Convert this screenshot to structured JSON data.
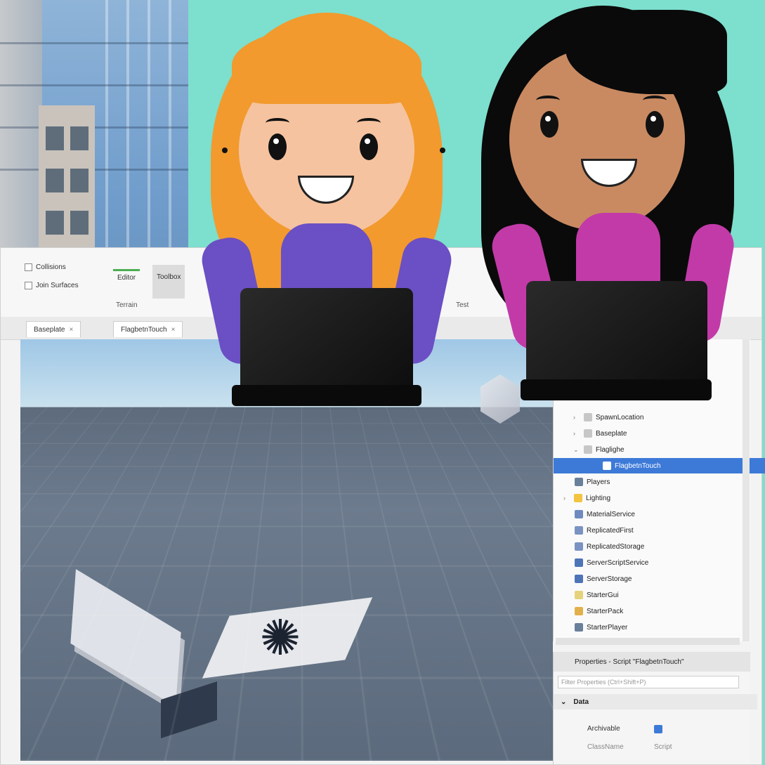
{
  "ribbon": {
    "checkbox_1": "Collisions",
    "checkbox_2": "Join Surfaces",
    "btn_1": "Editor",
    "btn_2": "Toolbox",
    "group_1": "Terrain",
    "group_2": "Test"
  },
  "tabs": [
    {
      "label": "Baseplate"
    },
    {
      "label": "FlagbetnTouch"
    }
  ],
  "explorer": {
    "items": [
      {
        "label": "SpawnLocation"
      },
      {
        "label": "Baseplate"
      },
      {
        "label": "Flaglighe"
      },
      {
        "label": "FlagbetnTouch"
      },
      {
        "label": "Players"
      },
      {
        "label": "Lighting"
      },
      {
        "label": "MaterialService"
      },
      {
        "label": "ReplicatedFirst"
      },
      {
        "label": "ReplicatedStorage"
      },
      {
        "label": "ServerScriptService"
      },
      {
        "label": "ServerStorage"
      },
      {
        "label": "StarterGui"
      },
      {
        "label": "StarterPack"
      },
      {
        "label": "StarterPlayer"
      }
    ]
  },
  "properties": {
    "title": "Properties - Script \"FlagbetnTouch\"",
    "filter_placeholder": "Filter Properties (Ctrl+Shift+P)",
    "section": "Data",
    "row_1_label": "Archivable",
    "row_2_label": "ClassName",
    "row_2_value": "Script"
  },
  "colors": {
    "background": "#7ddfcd",
    "selection": "#3d7ad8",
    "hair_blonde": "#f29a2e",
    "hair_black": "#0a0a0a",
    "shirt_purple": "#6b4fc4",
    "shirt_magenta": "#c23aa8"
  }
}
